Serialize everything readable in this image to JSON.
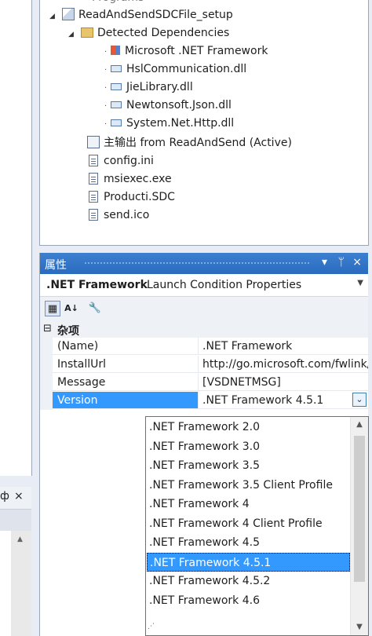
{
  "window_left": {
    "pin_label": "ф",
    "close_label": "×",
    "scroll_up": "▲"
  },
  "tree": {
    "cut_top_label": "Programs",
    "project": {
      "label": "ReadAndSendSDCFile_setup"
    },
    "detected_dependencies": {
      "label": "Detected Dependencies"
    },
    "dependencies": [
      {
        "label": "Microsoft .NET Framework",
        "icon": "framework-icon"
      },
      {
        "label": "HslCommunication.dll",
        "icon": "assembly-icon"
      },
      {
        "label": "JieLibrary.dll",
        "icon": "assembly-icon"
      },
      {
        "label": "Newtonsoft.Json.dll",
        "icon": "assembly-icon"
      },
      {
        "label": "System.Net.Http.dll",
        "icon": "assembly-icon"
      }
    ],
    "items": [
      {
        "label": "主输出 from ReadAndSend (Active)",
        "icon": "primary-output-icon"
      },
      {
        "label": "config.ini",
        "icon": "file-icon"
      },
      {
        "label": "msiexec.exe",
        "icon": "file-icon"
      },
      {
        "label": "Producti.SDC",
        "icon": "file-icon"
      },
      {
        "label": "send.ico",
        "icon": "file-icon"
      }
    ]
  },
  "properties": {
    "title": "属性",
    "title_controls": {
      "dropdown": "▾",
      "pin": "ᛘ",
      "close": "×"
    },
    "object_name": ".NET Framework",
    "object_desc": "Launch Condition Properties",
    "toolbar": {
      "categorized": "▦",
      "alphabetical": "A↓",
      "pages": "🔧"
    },
    "category": {
      "toggle": "⊟",
      "label": "杂项"
    },
    "rows": [
      {
        "name": "(Name)",
        "value": ".NET Framework"
      },
      {
        "name": "InstallUrl",
        "value": "http://go.microsoft.com/fwlink/"
      },
      {
        "name": "Message",
        "value": "[VSDNETMSG]"
      },
      {
        "name": "Version",
        "value": ".NET Framework 4.5.1"
      }
    ],
    "combo_glyph": "⌄"
  },
  "dropdown": {
    "options": [
      ".NET Framework 2.0",
      ".NET Framework 3.0",
      ".NET Framework 3.5",
      ".NET Framework 3.5 Client Profile",
      ".NET Framework 4",
      ".NET Framework 4 Client Profile",
      ".NET Framework 4.5",
      ".NET Framework 4.5.1",
      ".NET Framework 4.5.2",
      ".NET Framework 4.6"
    ],
    "selected_index": 7,
    "scroll_up": "▲",
    "scroll_down": "▼",
    "grip": "⋰"
  },
  "colors": {
    "accent": "#3399ff",
    "title_bar": "#2f72c4"
  }
}
